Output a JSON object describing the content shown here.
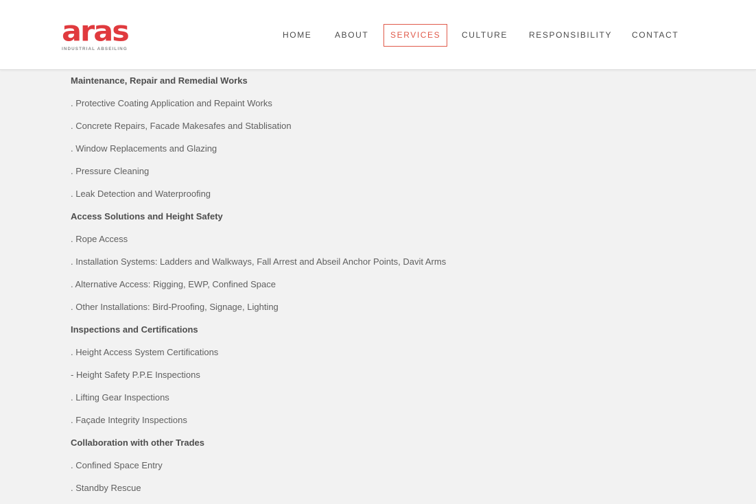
{
  "brand": {
    "name": "aras",
    "tagline": "INDUSTRIAL ABSEILING",
    "color": "#e03a3e"
  },
  "nav": {
    "items": [
      {
        "label": "HOME"
      },
      {
        "label": "ABOUT"
      },
      {
        "label": "SERVICES",
        "active": true
      },
      {
        "label": "CULTURE"
      },
      {
        "label": "RESPONSIBILITY"
      },
      {
        "label": "CONTACT"
      }
    ],
    "active_color": "#e05a4a"
  },
  "services": [
    {
      "title": "Maintenance, Repair and Remedial Works",
      "items": [
        ". Protective Coating Application and Repaint Works",
        ". Concrete Repairs, Facade Makesafes and Stablisation",
        ". Window Replacements and Glazing",
        ". Pressure Cleaning",
        ". Leak Detection and Waterproofing"
      ]
    },
    {
      "title": "Access Solutions and Height Safety",
      "items": [
        ". Rope Access",
        ". Installation Systems: Ladders and Walkways, Fall Arrest and Abseil Anchor Points, Davit Arms",
        ". Alternative Access: Rigging, EWP, Confined Space",
        ". Other Installations: Bird-Proofing, Signage, Lighting"
      ]
    },
    {
      "title": "Inspections and Certifications",
      "items": [
        ". Height Access System Certifications",
        "- Height Safety P.P.E Inspections",
        ". Lifting Gear Inspections",
        ". Façade Integrity Inspections"
      ]
    },
    {
      "title": "Collaboration with other Trades",
      "items": [
        ". Confined Space Entry",
        ". Standby Rescue"
      ]
    }
  ]
}
